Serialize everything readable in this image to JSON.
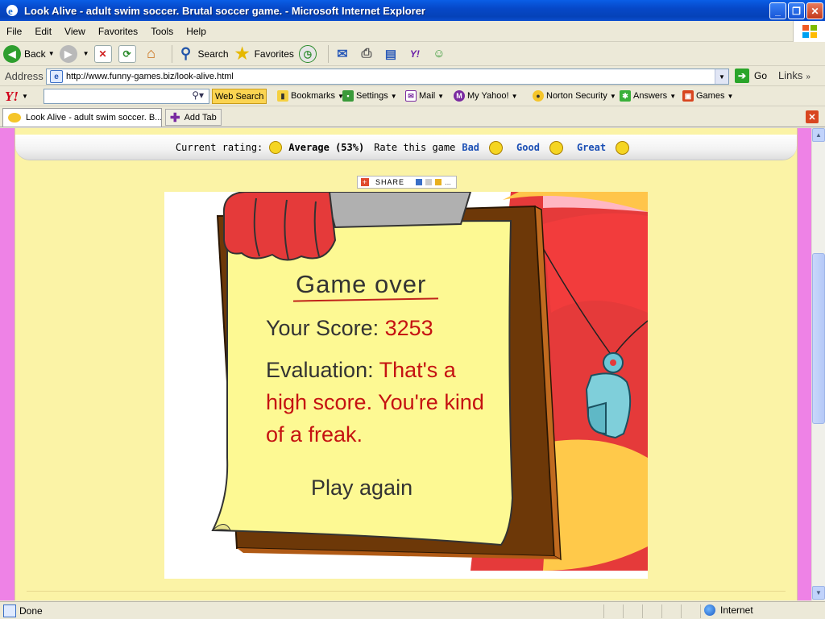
{
  "window": {
    "title": "Look Alive - adult swim soccer. Brutal soccer game. - Microsoft Internet Explorer",
    "minimize": "_",
    "restore": "❐",
    "close": "✕"
  },
  "menu": [
    "File",
    "Edit",
    "View",
    "Favorites",
    "Tools",
    "Help"
  ],
  "toolbar": {
    "back": "Back",
    "search": "Search",
    "favorites": "Favorites"
  },
  "address": {
    "label": "Address",
    "url": "http://www.funny-games.biz/look-alive.html",
    "go": "Go",
    "links": "Links"
  },
  "yahoo": {
    "logo": "Y!",
    "search_value": "",
    "web_search": "Web Search",
    "bookmarks": "Bookmarks",
    "settings": "Settings",
    "mail": "Mail",
    "my_yahoo": "My Yahoo!",
    "norton": "Norton Security",
    "answers": "Answers",
    "games": "Games"
  },
  "tabs": {
    "active_tab": "Look Alive - adult swim soccer. B...",
    "add_tab": "Add Tab"
  },
  "rating": {
    "current_label": "Current rating:",
    "current_value": "Average (53%)",
    "rate_label": "Rate this game",
    "bad": "Bad",
    "good": "Good",
    "great": "Great"
  },
  "share": {
    "label": "SHARE"
  },
  "game": {
    "title": "Game over",
    "score_label": "Your Score:",
    "score_value": "3253",
    "evaluation_label": "Evaluation:",
    "evaluation_text": "That's a high score. You're kind of a freak.",
    "play_again": "Play again"
  },
  "status": {
    "text": "Done",
    "zone": "Internet"
  }
}
